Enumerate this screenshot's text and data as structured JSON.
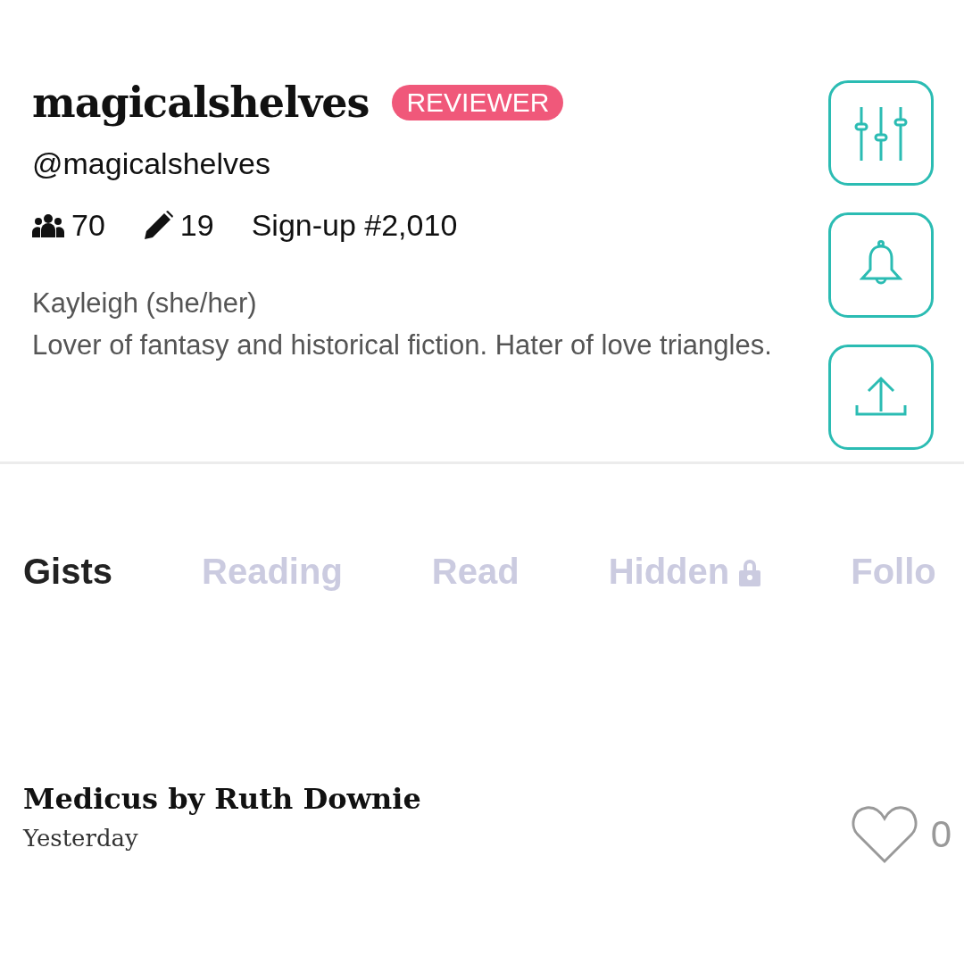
{
  "profile": {
    "display_name": "magicalshelves",
    "badge": "REVIEWER",
    "handle": "@magicalshelves",
    "stats": [
      {
        "kind": "followers",
        "text": "70"
      },
      {
        "kind": "posts",
        "text": "19"
      },
      {
        "kind": "plain",
        "text": "Sign-up #2,010"
      }
    ],
    "bio": [
      "Kayleigh (she/her)",
      "Lover of fantasy and historical fiction. Hater of love triangles."
    ]
  },
  "actions": [
    {
      "kind": "filters"
    },
    {
      "kind": "notifications"
    },
    {
      "kind": "share"
    }
  ],
  "tabs": [
    {
      "label": "Gists",
      "selected": true,
      "locked": false
    },
    {
      "label": "Reading",
      "selected": false,
      "locked": false
    },
    {
      "label": "Read",
      "selected": false,
      "locked": false
    },
    {
      "label": "Hidden",
      "selected": false,
      "locked": true
    },
    {
      "label": "Follo",
      "selected": false,
      "locked": false
    }
  ],
  "gists": [
    {
      "title": "Medicus by Ruth Downie",
      "date": "Yesterday",
      "likes": "0"
    }
  ]
}
